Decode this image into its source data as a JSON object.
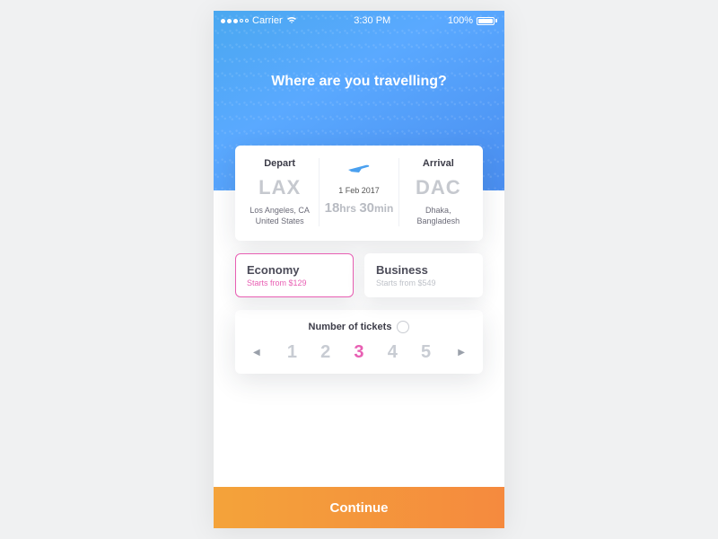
{
  "statusbar": {
    "carrier": "Carrier",
    "time": "3:30 PM",
    "battery_pct": "100%"
  },
  "hero": {
    "title": "Where are you travelling?"
  },
  "route": {
    "depart_label": "Depart",
    "depart_code": "LAX",
    "depart_city": "Los Angeles, CA",
    "depart_country": "United States",
    "date": "1 Feb 2017",
    "duration_hours": "18",
    "duration_hours_unit": "hrs",
    "duration_mins": "30",
    "duration_mins_unit": "min",
    "arrival_label": "Arrival",
    "arrival_code": "DAC",
    "arrival_city": "Dhaka,",
    "arrival_country": "Bangladesh"
  },
  "classes": {
    "economy": {
      "title": "Economy",
      "sub": "Starts from $129",
      "selected": true
    },
    "business": {
      "title": "Business",
      "sub": "Starts from $549",
      "selected": false
    }
  },
  "tickets": {
    "title": "Number of tickets",
    "numbers": [
      "1",
      "2",
      "3",
      "4",
      "5"
    ],
    "selected_index": 2
  },
  "cta": {
    "label": "Continue"
  }
}
